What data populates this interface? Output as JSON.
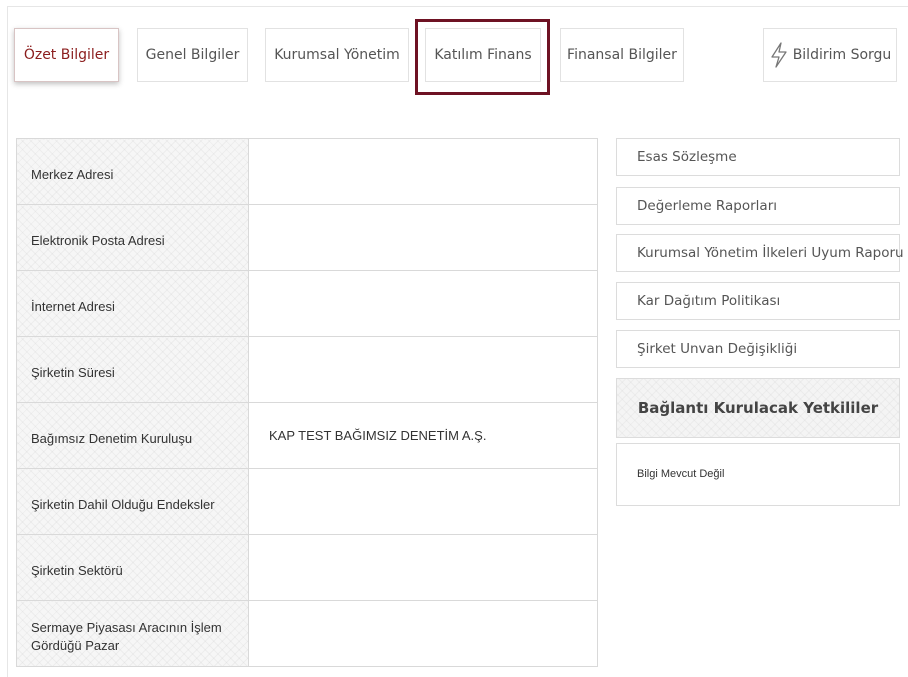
{
  "tabs": [
    {
      "label": "Özet Bilgiler",
      "active": true
    },
    {
      "label": "Genel Bilgiler",
      "active": false
    },
    {
      "label": "Kurumsal Yönetim",
      "active": false
    },
    {
      "label": "Katılım Finans",
      "active": false
    },
    {
      "label": "Finansal Bilgiler",
      "active": false
    },
    {
      "label": "Bildirim Sorgu",
      "active": false,
      "icon": "lightning-bolt-icon"
    }
  ],
  "info_table": {
    "rows": [
      {
        "label": "Merkez Adresi",
        "value": ""
      },
      {
        "label": "Elektronik Posta Adresi",
        "value": ""
      },
      {
        "label": "İnternet Adresi",
        "value": ""
      },
      {
        "label": "Şirketin Süresi",
        "value": ""
      },
      {
        "label": "Bağımsız Denetim Kuruluşu",
        "value": "KAP TEST BAĞIMSIZ DENETİM A.Ş."
      },
      {
        "label": "Şirketin Dahil Olduğu Endeksler",
        "value": ""
      },
      {
        "label": "Şirketin Sektörü",
        "value": ""
      },
      {
        "label": "Sermaye Piyasası Aracının İşlem Gördüğü Pazar",
        "value": ""
      }
    ]
  },
  "side_links": [
    "Esas Sözleşme",
    "Değerleme Raporları",
    "Kurumsal Yönetim İlkeleri Uyum Raporu",
    "Kar Dağıtım Politikası",
    "Şirket Unvan Değişikliği"
  ],
  "contacts": {
    "title": "Bağlantı Kurulacak Yetkililer",
    "empty_text": "Bilgi Mevcut Değil"
  },
  "colors": {
    "accent": "#8b1d1d",
    "highlight_border": "#6e1223"
  }
}
